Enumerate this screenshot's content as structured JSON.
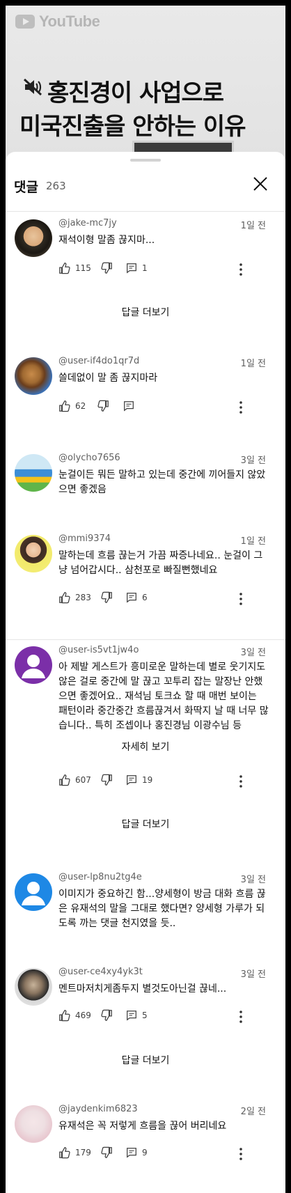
{
  "video": {
    "logo_text": "YouTube",
    "title_line1": "홍진경이 사업으로",
    "title_line2": "미국진출을 안하는 이유",
    "muted_icon": "volume-off-icon"
  },
  "sheet": {
    "title": "댓글",
    "count": "263",
    "close_icon": "close-icon"
  },
  "comments": [
    {
      "author": "@jake-mc7jy",
      "time": "1일 전",
      "text": "재석이형 말좀 끊지마...",
      "likes": "115",
      "replies": "1",
      "reply_link": "답글 더보기"
    },
    {
      "author": "@user-if4do1qr7d",
      "time": "1일 전",
      "text": "쓸데없이 말 좀 끊지마라",
      "likes": "62",
      "replies": "",
      "reply_link": ""
    },
    {
      "author": "@olycho7656",
      "time": "3일 전",
      "text": "눈걸이든 뭐든 말하고 있는데 중간에 끼어들지 않았으면 좋겠음",
      "likes": "",
      "replies": "",
      "reply_link": ""
    },
    {
      "author": "@mmi9374",
      "time": "1일 전",
      "text": "말하는데 흐름 끊는거  가끔 짜증나네요.. 눈걸이 그냥 넘어갑시다..  삼천포로 빠질뻔했네요",
      "likes": "283",
      "replies": "6",
      "reply_link": ""
    },
    {
      "author": "@user-is5vt1jw4o",
      "time": "3일 전",
      "text": "아 제발 게스트가 흥미로운 말하는데 별로 웃기지도 않은 걸로 중간에 말 끊고 꼬투리 잡는 말장난 안했으면 좋겠어요.. 재석님 토크쇼 할 때 매번 보이는 패턴이라 중간중간 흐름끊겨서 화딱지 날 때 너무 많습니다.. 특히 조셉이나 홍진경님 이광수님 등",
      "see_more": "자세히 보기",
      "likes": "607",
      "replies": "19",
      "reply_link": "답글 더보기"
    },
    {
      "author": "@user-lp8nu2tg4e",
      "time": "3일 전",
      "text": "이미지가 중요하긴 함...양세형이 방금 대화 흐름 끊은 유재석의 말을 그대로 했다면? 양세형 가루가 되도록 까는 댓글 천지였을 듯..",
      "likes": "",
      "replies": "",
      "reply_link": ""
    },
    {
      "author": "@user-ce4xy4yk3t",
      "time": "3일 전",
      "text": "멘트마저치게좀두지 별것도아닌걸 끊네...",
      "likes": "469",
      "replies": "5",
      "reply_link": "답글 더보기"
    },
    {
      "author": "@jaydenkim6823",
      "time": "2일 전",
      "text": "유재석은 꼭 저렇게 흐름을 끊어 버리네요",
      "likes": "179",
      "replies": "9",
      "reply_link": ""
    }
  ],
  "icons": {
    "like": "thumbs-up-icon",
    "dislike": "thumbs-down-icon",
    "reply": "comment-icon",
    "more": "more-vertical-icon"
  }
}
